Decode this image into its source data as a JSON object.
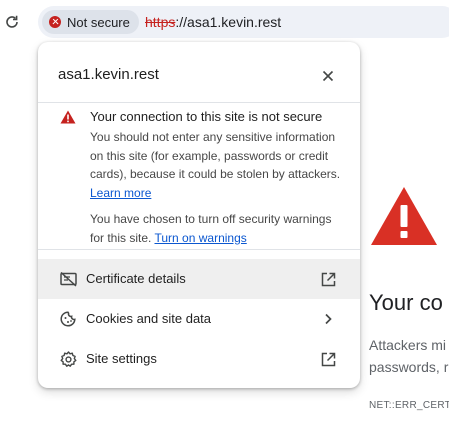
{
  "toolbar": {
    "reload_icon": "reload-icon",
    "security_chip": {
      "label": "Not secure",
      "icon": "not-secure-icon",
      "color": "#c5221f"
    },
    "url": {
      "scheme": "https",
      "rest": "://asa1.kevin.rest"
    }
  },
  "popup": {
    "title": "asa1.kevin.rest",
    "close_icon": "close-icon",
    "security": {
      "icon": "warning-icon",
      "heading": "Your connection to this site is not secure",
      "body": "You should not enter any sensitive information on this site (for example, passwords or credit cards), because it could be stolen by attackers.",
      "learn_more": "Learn more",
      "warning_text": "You have chosen to turn off security warnings for this site.",
      "turn_on": "Turn on warnings"
    },
    "rows": [
      {
        "label": "Certificate details",
        "icon": "certificate-icon",
        "end_icon": "open-external-icon"
      },
      {
        "label": "Cookies and site data",
        "icon": "cookie-icon",
        "end_icon": "chevron-right-icon"
      },
      {
        "label": "Site settings",
        "icon": "settings-icon",
        "end_icon": "open-external-icon"
      }
    ]
  },
  "page": {
    "heading": "Your co",
    "text": "Attackers mi passwords, r",
    "error_code": "NET::ERR_CERT_",
    "warning_color": "#d93025"
  }
}
